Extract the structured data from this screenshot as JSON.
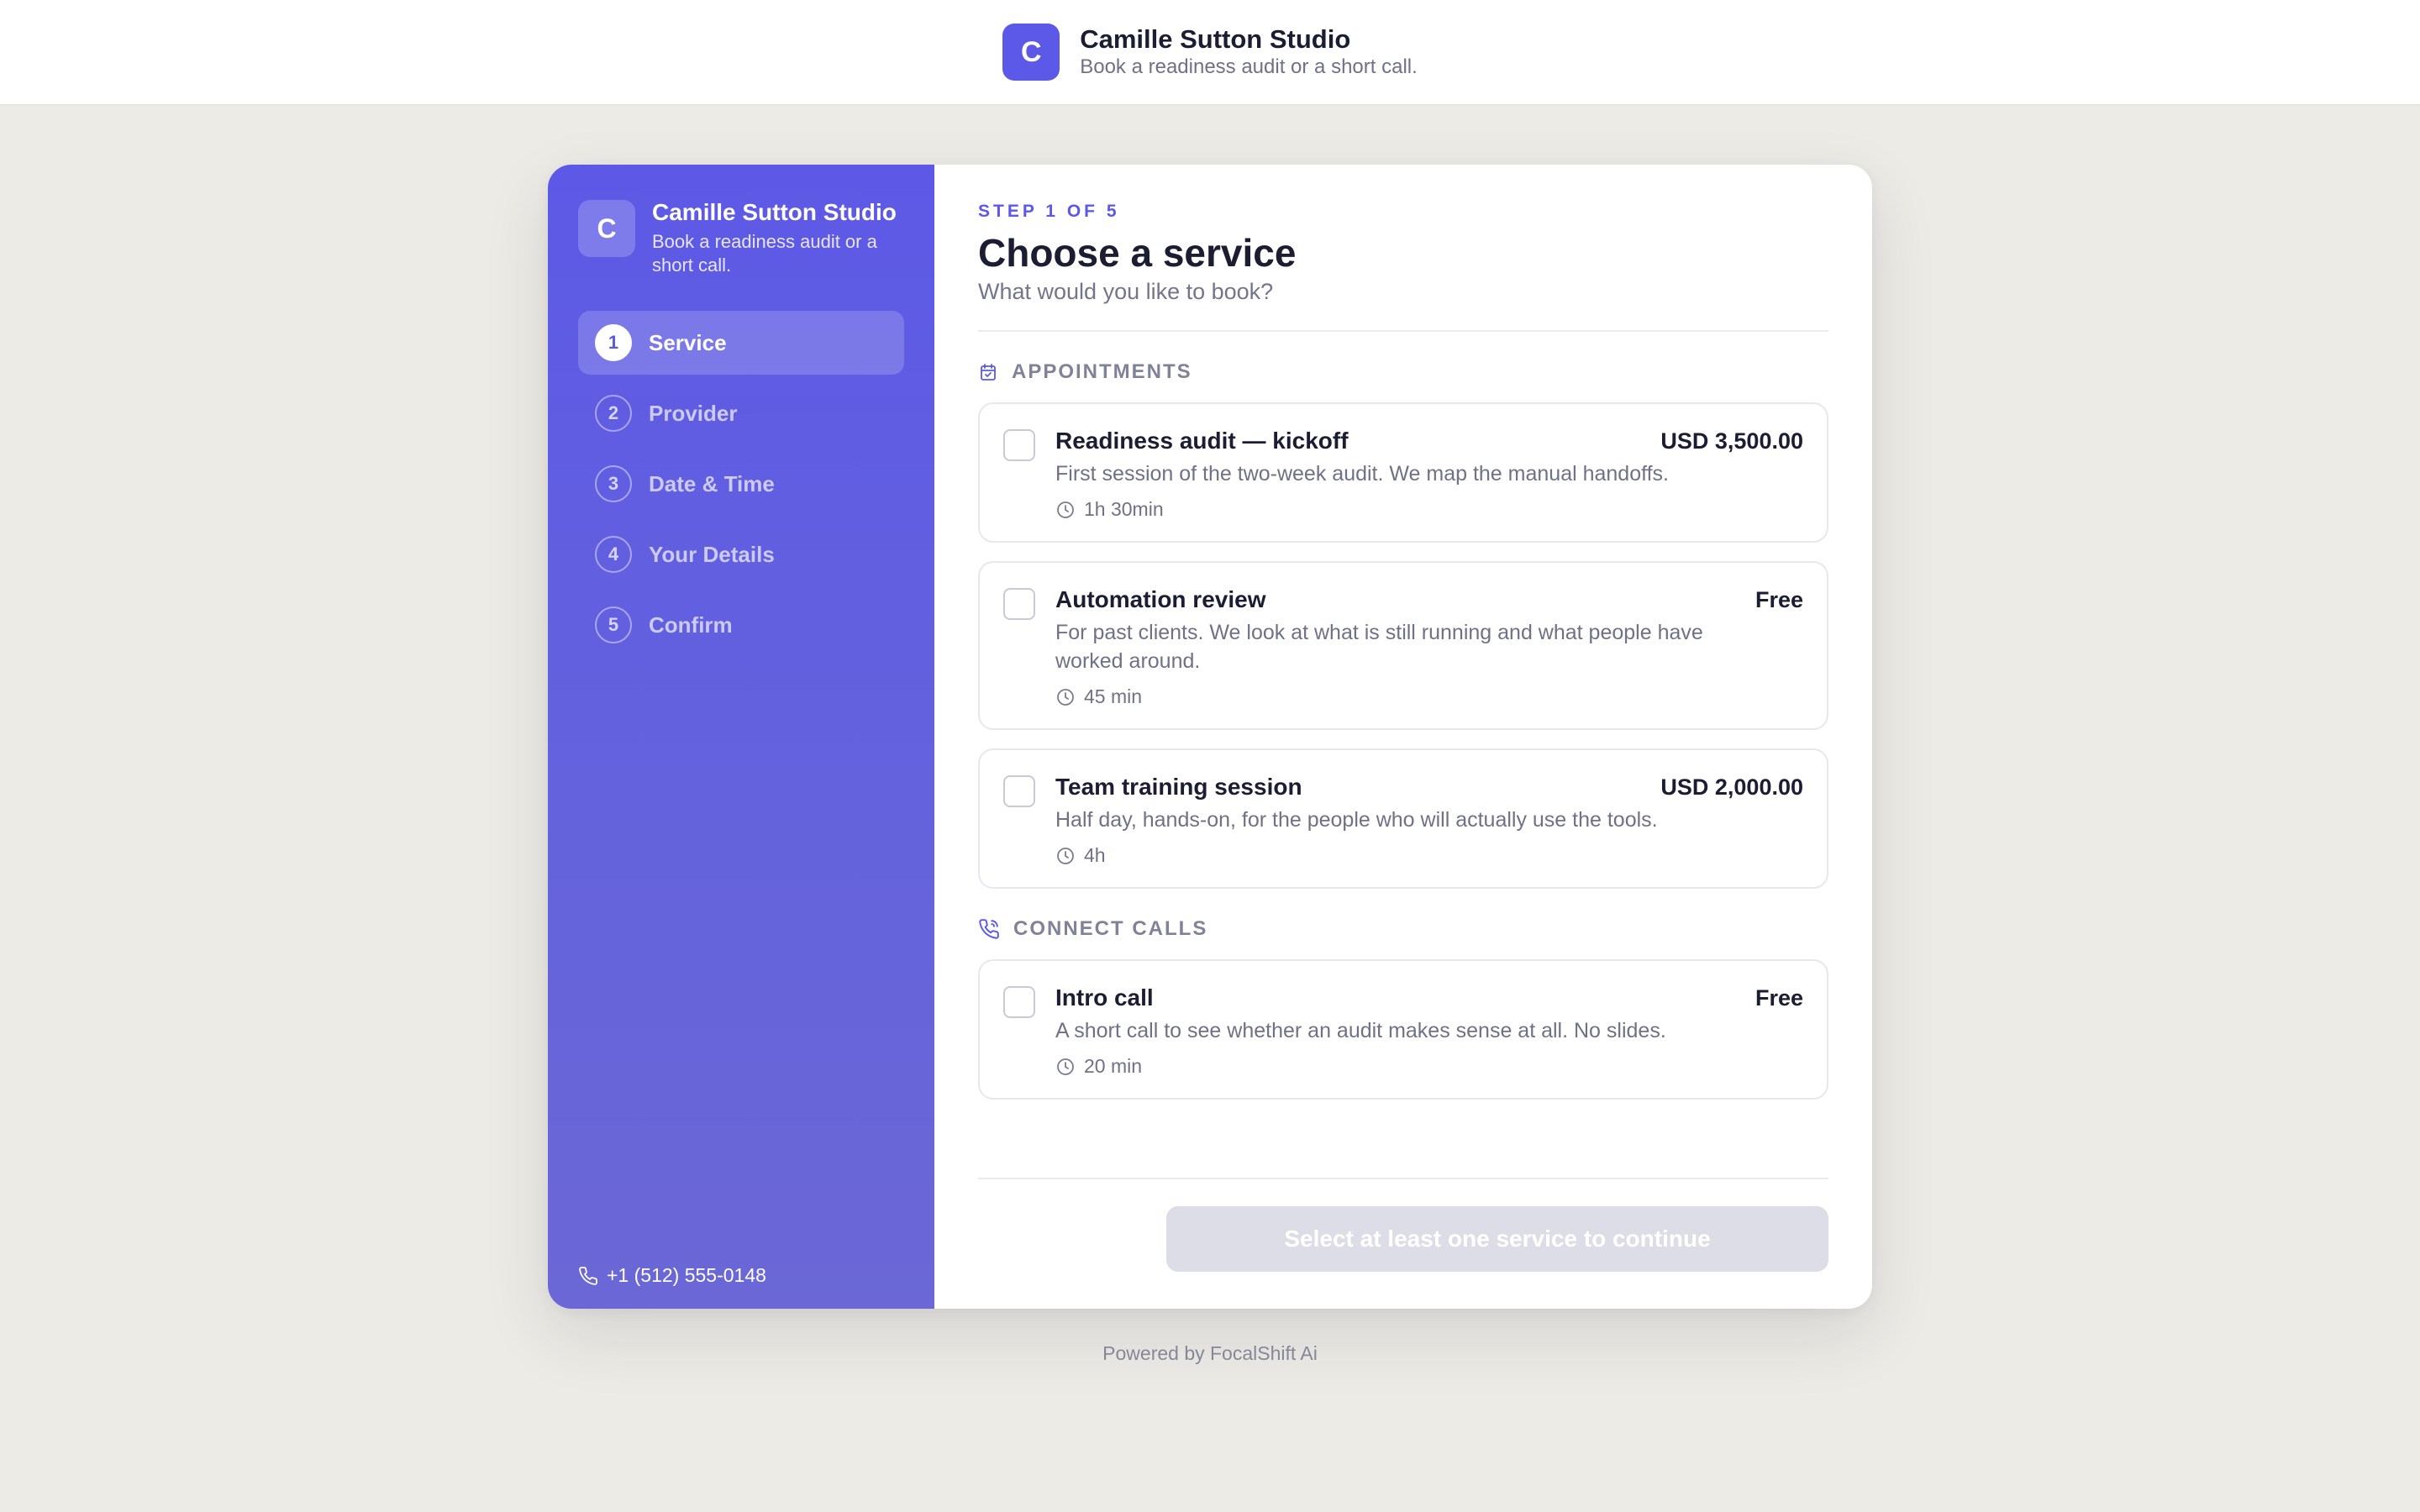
{
  "brand": {
    "initial": "C",
    "name": "Camille Sutton Studio",
    "tagline": "Book a readiness audit or a short call."
  },
  "sidebar": {
    "steps": [
      {
        "num": "1",
        "label": "Service",
        "active": true
      },
      {
        "num": "2",
        "label": "Provider",
        "active": false
      },
      {
        "num": "3",
        "label": "Date & Time",
        "active": false
      },
      {
        "num": "4",
        "label": "Your Details",
        "active": false
      },
      {
        "num": "5",
        "label": "Confirm",
        "active": false
      }
    ],
    "phone": "+1 (512) 555-0148"
  },
  "main": {
    "eyebrow": "STEP 1 OF 5",
    "title": "Choose a service",
    "subtitle": "What would you like to book?",
    "sections": [
      {
        "heading": "APPOINTMENTS",
        "icon": "calendar-check-icon",
        "services": [
          {
            "name": "Readiness audit — kickoff",
            "price": "USD 3,500.00",
            "description": "First session of the two-week audit. We map the manual handoffs.",
            "duration": "1h 30min",
            "checked": false
          },
          {
            "name": "Automation review",
            "price": "Free",
            "description": "For past clients. We look at what is still running and what people have worked around.",
            "duration": "45 min",
            "checked": false
          },
          {
            "name": "Team training session",
            "price": "USD 2,000.00",
            "description": "Half day, hands-on, for the people who will actually use the tools.",
            "duration": "4h",
            "checked": false
          }
        ]
      },
      {
        "heading": "CONNECT CALLS",
        "icon": "phone-call-icon",
        "services": [
          {
            "name": "Intro call",
            "price": "Free",
            "description": "A short call to see whether an audit makes sense at all. No slides.",
            "duration": "20 min",
            "checked": false
          }
        ]
      }
    ],
    "continue_label": "Select at least one service to continue"
  },
  "footer": {
    "powered_by": "Powered by FocalShift Ai"
  },
  "colors": {
    "accent": "#5c58e8",
    "page_bg": "#edebe6",
    "disabled_button": "#dcdde6"
  }
}
